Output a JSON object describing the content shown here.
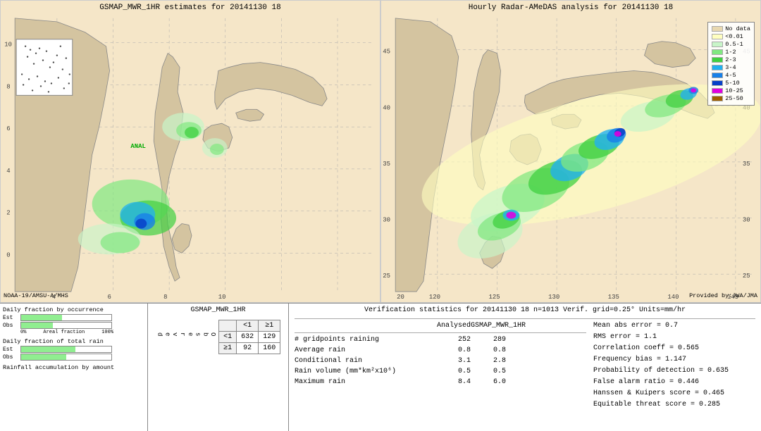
{
  "left_map": {
    "title": "GSMAP_MWR_1HR estimates for 20141130 18",
    "bottom_label": "NOAA-19/AMSU-A/MHS",
    "anal_label": "ANAL"
  },
  "right_map": {
    "title": "Hourly Radar-AMeDAS analysis for 20141130 18",
    "provided_by": "Provided by:JWA/JMA"
  },
  "legend": {
    "title": "",
    "items": [
      {
        "label": "No data",
        "color": "#e8d8b0"
      },
      {
        "label": "<0.01",
        "color": "#ffffc0"
      },
      {
        "label": "0.5-1",
        "color": "#c8f5c8"
      },
      {
        "label": "1-2",
        "color": "#80e880"
      },
      {
        "label": "2-3",
        "color": "#40d040"
      },
      {
        "label": "3-4",
        "color": "#20b0f0"
      },
      {
        "label": "4-5",
        "color": "#1880e8"
      },
      {
        "label": "5-10",
        "color": "#0840c8"
      },
      {
        "label": "10-25",
        "color": "#e000e0"
      },
      {
        "label": "25-50",
        "color": "#a06000"
      }
    ]
  },
  "bar_charts": {
    "occurrence_title": "Daily fraction by occurrence",
    "rain_title": "Daily fraction of total rain",
    "rainfall_title": "Rainfall accumulation by amount",
    "est_label": "Est",
    "obs_label": "Obs",
    "pct_0": "0%",
    "pct_100": "100%",
    "areal_fraction": "Areal fraction"
  },
  "contingency": {
    "title": "GSMAP_MWR_1HR",
    "col_lt1": "<1",
    "col_ge1": "≥1",
    "row_lt1": "<1",
    "row_ge1": "≥1",
    "observed_label": "O\nb\ns\ne\nr\nv\ne\nd",
    "val_lt1_lt1": "632",
    "val_lt1_ge1": "129",
    "val_ge1_lt1": "92",
    "val_ge1_ge1": "160"
  },
  "verification": {
    "title": "Verification statistics for 20141130 18  n=1013  Verif. grid=0.25°  Units=mm/hr",
    "headers": [
      "Analysed",
      "GSMAP_MWR_1HR"
    ],
    "rows": [
      {
        "label": "# gridpoints raining",
        "analysed": "252",
        "gsmap": "289"
      },
      {
        "label": "Average rain",
        "analysed": "0.8",
        "gsmap": "0.8"
      },
      {
        "label": "Conditional rain",
        "analysed": "3.1",
        "gsmap": "2.8"
      },
      {
        "label": "Rain volume (mm*km²x10⁶)",
        "analysed": "0.5",
        "gsmap": "0.5"
      },
      {
        "label": "Maximum rain",
        "analysed": "8.4",
        "gsmap": "6.0"
      }
    ],
    "right_stats": [
      {
        "label": "Mean abs error = 0.7"
      },
      {
        "label": "RMS error = 1.1"
      },
      {
        "label": "Correlation coeff = 0.565"
      },
      {
        "label": "Frequency bias = 1.147"
      },
      {
        "label": "Probability of detection = 0.635"
      },
      {
        "label": "False alarm ratio = 0.446"
      },
      {
        "label": "Hanssen & Kuipers score = 0.465"
      },
      {
        "label": "Equitable threat score = 0.285"
      }
    ]
  }
}
